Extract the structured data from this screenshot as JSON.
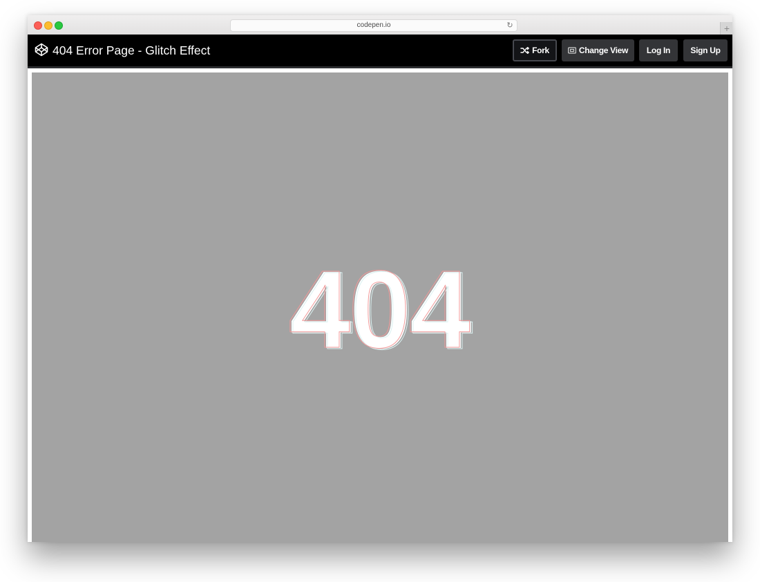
{
  "browser": {
    "url": "codepen.io"
  },
  "header": {
    "title": "404 Error Page - Glitch Effect",
    "buttons": {
      "fork": "Fork",
      "change_view": "Change View",
      "login": "Log In",
      "signup": "Sign Up"
    }
  },
  "preview": {
    "heading": "404",
    "background_color": "#a3a3a3",
    "glitch_colors": [
      "#f29a9a",
      "#d9f0f0"
    ]
  },
  "icons": {
    "logo": "codepen-logo-icon",
    "fork": "fork-icon",
    "change_view": "change-view-icon",
    "reload": "reload-icon"
  }
}
